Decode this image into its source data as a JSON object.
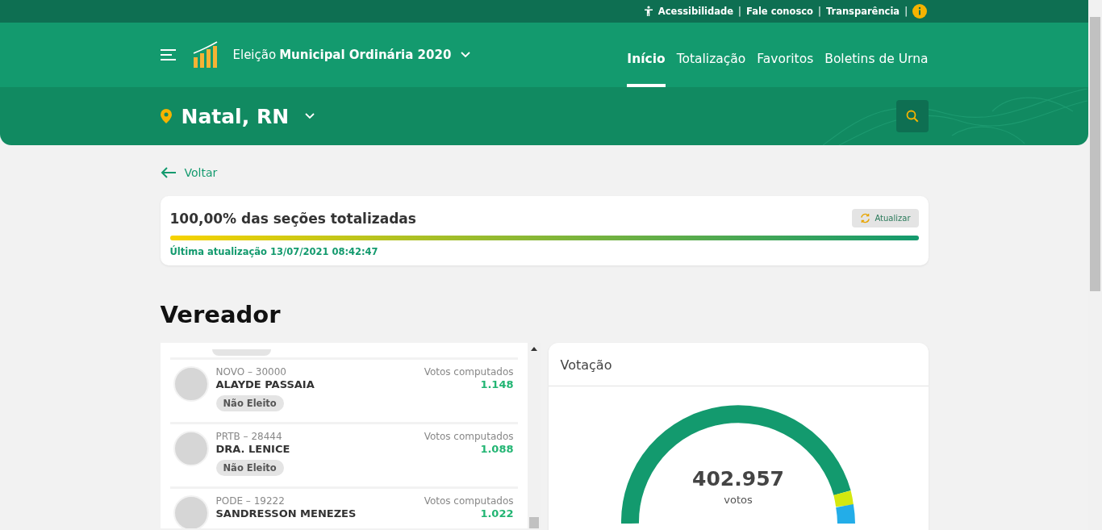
{
  "top_links": [
    {
      "label": "Acessibilidade",
      "separator": "|"
    },
    {
      "label": "Fale conosco",
      "separator": "|"
    },
    {
      "label": "Transparência",
      "separator": "|"
    }
  ],
  "header": {
    "election_prefix": "Eleição",
    "election_name": "Municipal Ordinária 2020"
  },
  "nav": [
    {
      "label": "Início",
      "selected": true
    },
    {
      "label": "Totalização",
      "selected": false
    },
    {
      "label": "Favoritos",
      "selected": false
    },
    {
      "label": "Boletins de Urna",
      "selected": false
    }
  ],
  "location": "Natal, RN",
  "back": "Voltar",
  "progress": {
    "title": "100,00% das seções totalizadas",
    "level": 1,
    "button": "Atualizar",
    "updated": "Última atualização 13/07/2021 08:42:47"
  },
  "section_title": "Vereador",
  "candidates": [
    {
      "party": "NOVO – 30000",
      "name": "ALAYDE PASSAIA",
      "votes_label": "Votos computados",
      "votes": "1.148",
      "status": "Não Eleito"
    },
    {
      "party": "PRTB – 28444",
      "name": "DRA. LENICE",
      "votes_label": "Votos computados",
      "votes": "1.088",
      "status": "Não Eleito"
    },
    {
      "party": "PODE – 19222",
      "name": "SANDRESSON MENEZES",
      "votes_label": "Votos computados",
      "votes": "1.022"
    }
  ],
  "votes_card": {
    "title": "Votação",
    "total": "402.957",
    "unit": "votos"
  }
}
